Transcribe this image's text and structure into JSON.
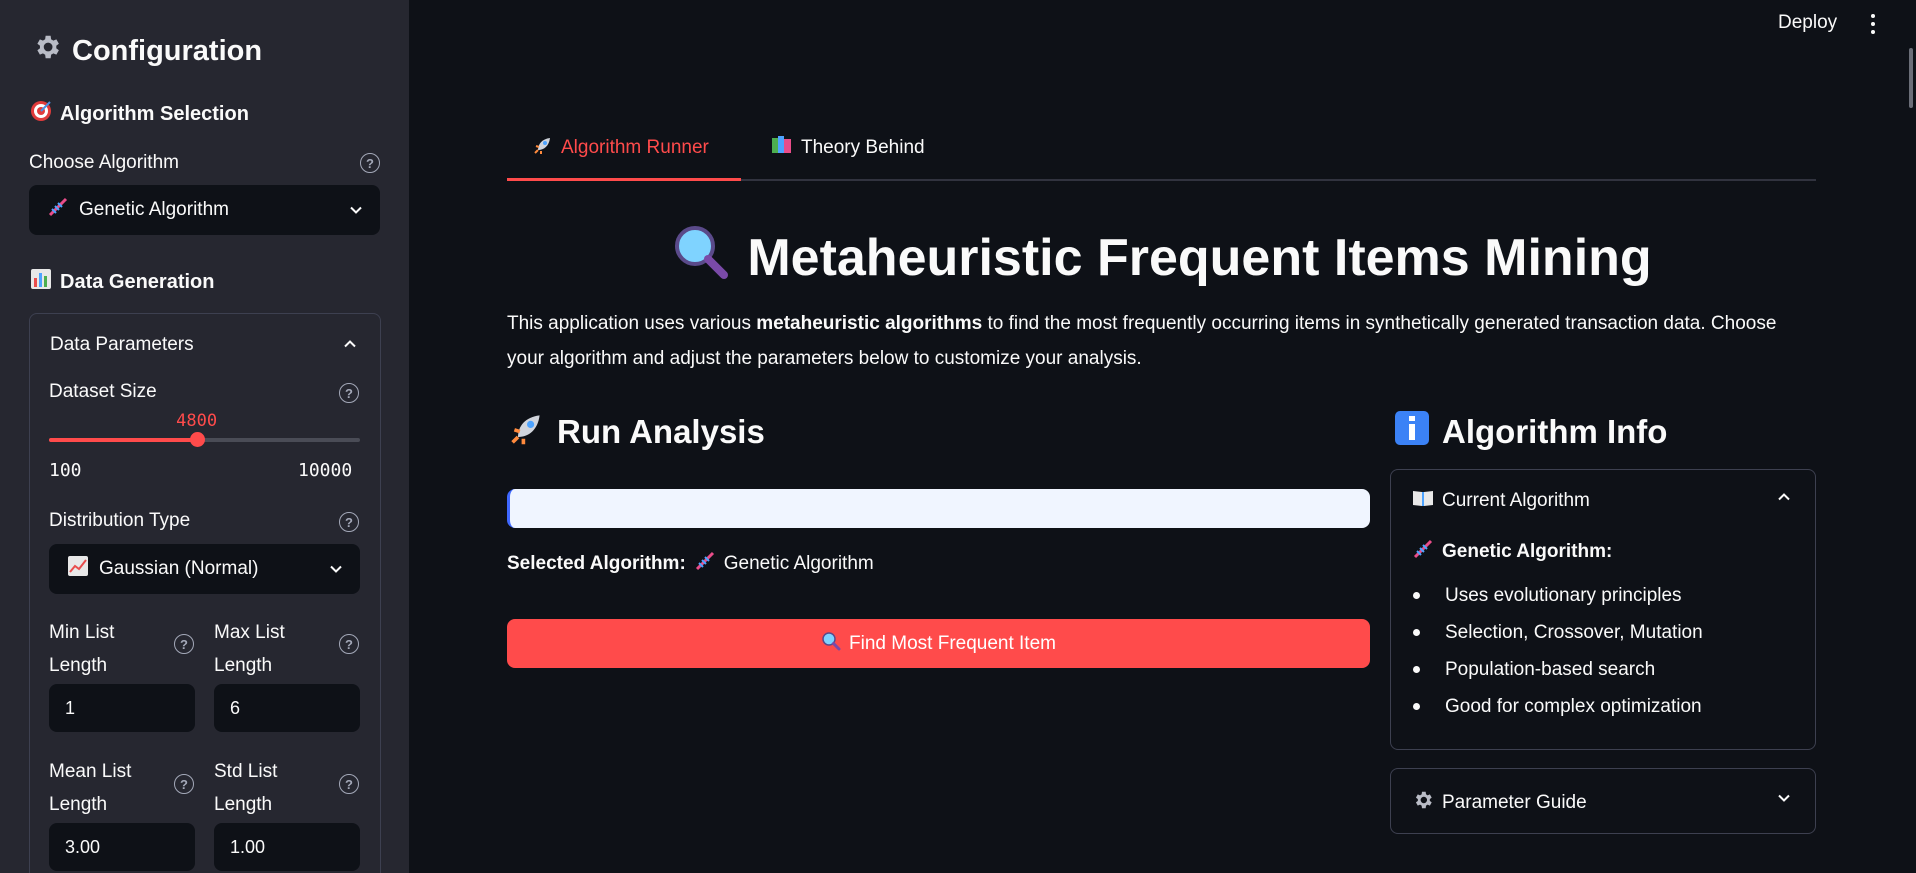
{
  "sidebar": {
    "title": "Configuration",
    "algorithm_section": "Algorithm Selection",
    "choose_algorithm_label": "Choose Algorithm",
    "choose_algorithm_value": "Genetic Algorithm",
    "data_section": "Data Generation",
    "data_params_expander": "Data Parameters",
    "dataset_size_label": "Dataset Size",
    "dataset_size": {
      "value": 4800,
      "min": 100,
      "max": 10000,
      "value_text": "4800",
      "min_text": "100",
      "max_text": "10000"
    },
    "distribution_label": "Distribution Type",
    "distribution_value": "Gaussian (Normal)",
    "min_list_label": "Min List Length",
    "min_list_label_1": "Min List",
    "min_list_label_2": "Length",
    "min_list_value": "1",
    "max_list_label_1": "Max List",
    "max_list_label_2": "Length",
    "max_list_value": "6",
    "mean_list_label_1": "Mean List",
    "mean_list_label_2": "Length",
    "mean_list_value": "3.00",
    "std_list_label_1": "Std List",
    "std_list_label_2": "Length",
    "std_list_value": "1.00"
  },
  "header": {
    "deploy_label": "Deploy"
  },
  "tabs": [
    {
      "label": "Algorithm Runner",
      "active": true
    },
    {
      "label": "Theory Behind",
      "active": false
    }
  ],
  "main": {
    "title": "Metaheuristic Frequent Items Mining",
    "intro_prefix": "This application uses various ",
    "intro_bold": "metaheuristic algorithms",
    "intro_suffix": " to find the most frequently occurring items in synthetically generated transaction data. Choose your algorithm and adjust the parameters below to customize your analysis.",
    "run_heading": "Run Analysis",
    "selected_label": "Selected Algorithm:",
    "selected_value": "Genetic Algorithm",
    "run_button": "Find Most Frequent Item",
    "info_heading": "Algorithm Info",
    "current_algo_expander": "Current Algorithm",
    "current_algo_name": "Genetic Algorithm:",
    "bullets": [
      "Uses evolutionary principles",
      "Selection, Crossover, Mutation",
      "Population-based search",
      "Good for complex optimization"
    ],
    "param_guide_expander": "Parameter Guide"
  },
  "colors": {
    "accent": "#ff4b4b",
    "sidebar_bg": "#262730",
    "app_bg": "#0e1117",
    "progress_bg": "#f0f5ff"
  },
  "icons": [
    "gear-icon",
    "target-icon",
    "dna-icon",
    "bar-chart-icon",
    "chart-up-icon",
    "rocket-icon",
    "books-icon",
    "magnifier-icon",
    "info-icon",
    "book-icon",
    "help-icon",
    "chevron-down-icon",
    "chevron-up-icon",
    "kebab-menu-icon"
  ]
}
